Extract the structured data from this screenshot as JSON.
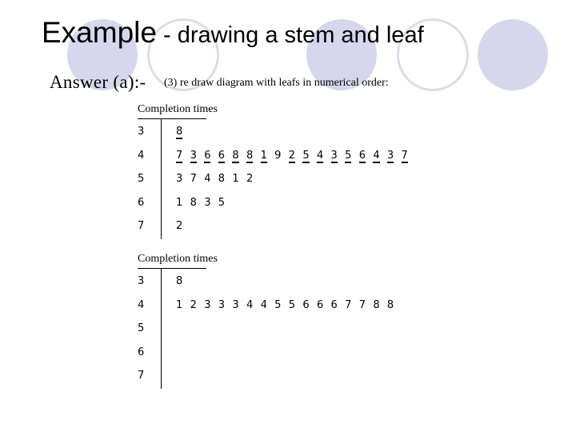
{
  "decor": {
    "circles": [
      {
        "style": "filled",
        "color": "#d6d6ec"
      },
      {
        "style": "outline",
        "color": "#dcdcea"
      },
      {
        "style": "filled",
        "color": "#d6d6ec"
      },
      {
        "style": "outline",
        "color": "#dcdcea"
      },
      {
        "style": "filled",
        "color": "#d6d6ec"
      }
    ]
  },
  "title": {
    "main": "Example",
    "sub": " - drawing a stem and leaf"
  },
  "answer_label": "Answer (a):-",
  "instruction": "(3)  re draw diagram with leafs in numerical order:",
  "tables": [
    {
      "header": "Completion times",
      "rows": [
        {
          "stem": "3",
          "leaves": [
            {
              "v": "8",
              "u": true
            }
          ]
        },
        {
          "stem": "4",
          "leaves": [
            {
              "v": "7",
              "u": true
            },
            {
              "v": "3",
              "u": true
            },
            {
              "v": "6",
              "u": true
            },
            {
              "v": "6",
              "u": true
            },
            {
              "v": "8",
              "u": true
            },
            {
              "v": "8",
              "u": true
            },
            {
              "v": "1",
              "u": true
            },
            {
              "v": "9",
              "u": false
            },
            {
              "v": "2",
              "u": true
            },
            {
              "v": "5",
              "u": true
            },
            {
              "v": "4",
              "u": true
            },
            {
              "v": "3",
              "u": true
            },
            {
              "v": "5",
              "u": true
            },
            {
              "v": "6",
              "u": true
            },
            {
              "v": "4",
              "u": true
            },
            {
              "v": "3",
              "u": true
            },
            {
              "v": "7",
              "u": true
            }
          ]
        },
        {
          "stem": "5",
          "leaves": [
            {
              "v": "3",
              "u": false
            },
            {
              "v": "7",
              "u": false
            },
            {
              "v": "4",
              "u": false
            },
            {
              "v": "8",
              "u": false
            },
            {
              "v": "1",
              "u": false
            },
            {
              "v": "2",
              "u": false
            }
          ]
        },
        {
          "stem": "6",
          "leaves": [
            {
              "v": "1",
              "u": false
            },
            {
              "v": "8",
              "u": false
            },
            {
              "v": "3",
              "u": false
            },
            {
              "v": "5",
              "u": false
            }
          ]
        },
        {
          "stem": "7",
          "leaves": [
            {
              "v": "2",
              "u": false
            }
          ]
        }
      ]
    },
    {
      "header": "Completion times",
      "rows": [
        {
          "stem": "3",
          "leaves": [
            {
              "v": "8",
              "u": false
            }
          ]
        },
        {
          "stem": "4",
          "leaves": [
            {
              "v": "1",
              "u": false
            },
            {
              "v": "2",
              "u": false
            },
            {
              "v": "3",
              "u": false
            },
            {
              "v": "3",
              "u": false
            },
            {
              "v": "3",
              "u": false
            },
            {
              "v": "4",
              "u": false
            },
            {
              "v": "4",
              "u": false
            },
            {
              "v": "5",
              "u": false
            },
            {
              "v": "5",
              "u": false
            },
            {
              "v": "6",
              "u": false
            },
            {
              "v": "6",
              "u": false
            },
            {
              "v": "6",
              "u": false
            },
            {
              "v": "7",
              "u": false
            },
            {
              "v": "7",
              "u": false
            },
            {
              "v": "8",
              "u": false
            },
            {
              "v": "8",
              "u": false
            }
          ]
        },
        {
          "stem": "5",
          "leaves": []
        },
        {
          "stem": "6",
          "leaves": []
        },
        {
          "stem": "7",
          "leaves": []
        }
      ]
    }
  ]
}
